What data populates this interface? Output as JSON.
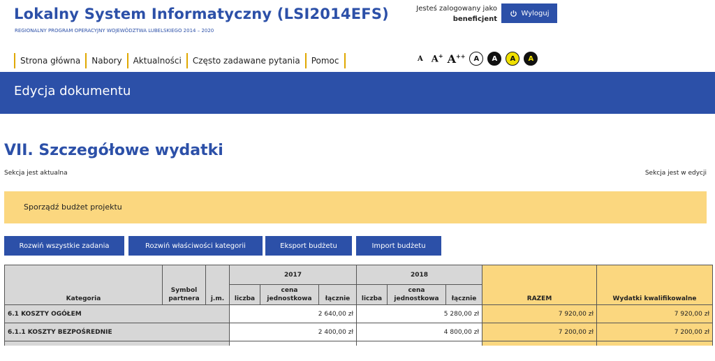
{
  "header": {
    "title": "Lokalny System Informatyczny (LSI2014EFS)",
    "subtitle": "REGIONALNY PROGRAM OPERACYJNY WOJEWÓDZTWA LUBELSKIEGO 2014 – 2020",
    "login_prefix": "Jesteś zalogowany jako",
    "login_user": "beneficjent",
    "logout_label": "Wyloguj"
  },
  "nav": {
    "items": [
      "Strona główna",
      "Nabory",
      "Aktualności",
      "Często zadawane pytania",
      "Pomoc"
    ]
  },
  "accessibility": {
    "font_small": "A",
    "font_medium": "A",
    "font_medium_sup": "+",
    "font_large": "A",
    "font_large_sup": "++",
    "contrast": [
      "A",
      "A",
      "A",
      "A"
    ]
  },
  "banner": {
    "title": "Edycja dokumentu"
  },
  "section": {
    "title": "VII. Szczegółowe wydatki",
    "status_left": "Sekcja jest aktualna",
    "status_right": "Sekcja jest w edycji",
    "notice": "Sporządź budżet projektu"
  },
  "buttons": {
    "expand_tasks": "Rozwiń wszystkie zadania",
    "expand_categories": "Rozwiń właściwości kategorii",
    "export_budget": "Eksport budżetu",
    "import_budget": "Import budżetu"
  },
  "table": {
    "col_category": "Kategoria",
    "col_symbol_line1": "Symbol",
    "col_symbol_line2": "partnera",
    "col_unit": "j.m.",
    "year1": "2017",
    "year2": "2018",
    "sub_count": "liczba",
    "sub_price_line1": "cena",
    "sub_price_line2": "jednostkowa",
    "sub_total": "łącznie",
    "col_sum": "RAZEM",
    "col_eligible": "Wydatki kwalifikowalne",
    "rows": [
      {
        "category": "6.1 KOSZTY OGÓŁEM",
        "y2017_total": "2 640,00 zł",
        "y2018_total": "5 280,00 zł",
        "sum": "7 920,00 zł",
        "eligible": "7 920,00 zł"
      },
      {
        "category": "6.1.1 KOSZTY BEZPOŚREDNIE",
        "y2017_total": "2 400,00 zł",
        "y2018_total": "4 800,00 zł",
        "sum": "7 200,00 zł",
        "eligible": "7 200,00 zł"
      }
    ]
  },
  "colors": {
    "brand_blue": "#2c50a8",
    "notice_yellow": "#fbd77f",
    "header_gray": "#d7d7d7",
    "nav_separator": "#e0a800"
  }
}
